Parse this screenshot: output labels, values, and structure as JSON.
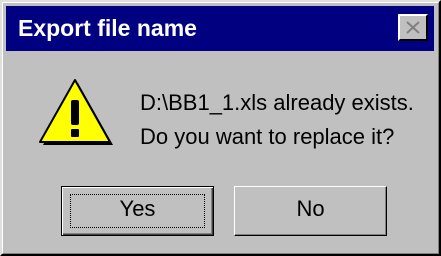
{
  "window": {
    "title": "Export file name",
    "close_icon": "close-icon"
  },
  "dialog": {
    "icon": "warning-icon",
    "message_line1": "D:\\BB1_1.xls already exists.",
    "message_line2": "Do you want to replace it?"
  },
  "buttons": {
    "yes_label": "Yes",
    "no_label": "No",
    "default": "yes"
  },
  "colors": {
    "titlebar": "#000080",
    "face": "#c0c0c0",
    "warning": "#ffff00"
  }
}
